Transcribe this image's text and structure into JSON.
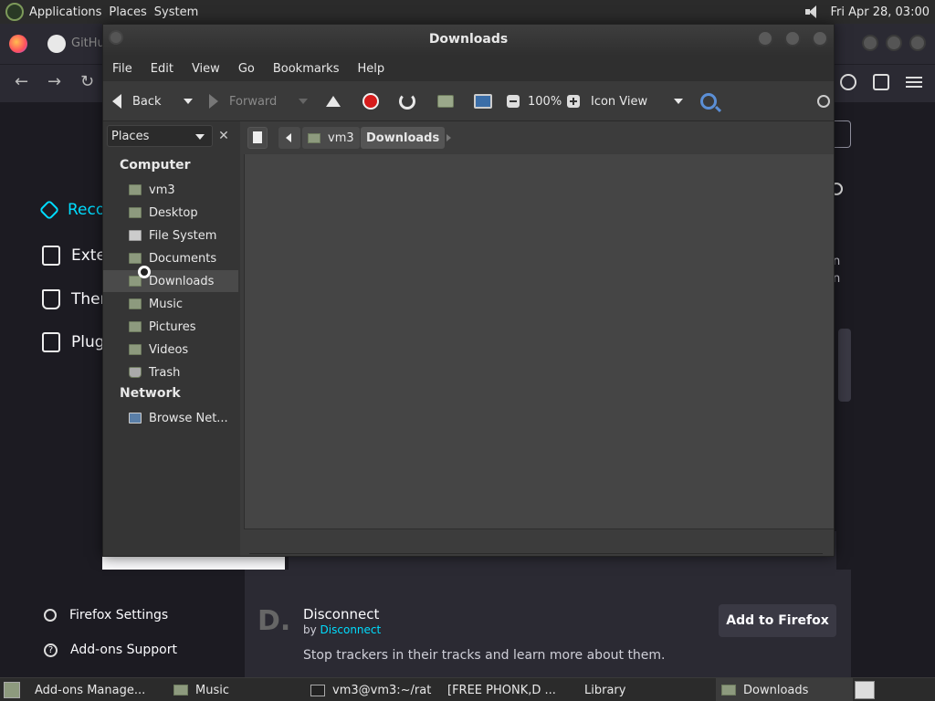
{
  "top_panel": {
    "menus": [
      "Applications",
      "Places",
      "System"
    ],
    "clock": "Fri Apr 28, 03:00"
  },
  "firefox": {
    "tab_partial": "GitHub",
    "sidebar": [
      {
        "label": "Recommendations",
        "shown": "Reco"
      },
      {
        "label": "Extensions",
        "shown": "Exte"
      },
      {
        "label": "Themes",
        "shown": "Ther"
      },
      {
        "label": "Plugins",
        "shown": "Plug"
      }
    ],
    "sidebar_bottom": [
      "Firefox Settings",
      "Add-ons Support"
    ],
    "peek_text": [
      "n",
      "n"
    ],
    "extension_card": {
      "logo": "D.",
      "name": "Disconnect",
      "by_prefix": "by",
      "author": "Disconnect",
      "description": "Stop trackers in their tracks and learn more about them.",
      "button": "Add to Firefox"
    }
  },
  "file_manager": {
    "title": "Downloads",
    "menu": [
      "File",
      "Edit",
      "View",
      "Go",
      "Bookmarks",
      "Help"
    ],
    "toolbar": {
      "back": "Back",
      "forward": "Forward",
      "zoom": "100%",
      "view_mode": "Icon View"
    },
    "sidebar": {
      "selector": "Places",
      "close": "✕",
      "computer_header": "Computer",
      "network_header": "Network",
      "items": [
        "vm3",
        "Desktop",
        "File System",
        "Documents",
        "Downloads",
        "Music",
        "Pictures",
        "Videos",
        "Trash"
      ],
      "network_items": [
        "Browse Net..."
      ]
    },
    "path": [
      "vm3",
      "Downloads"
    ]
  },
  "taskbar": {
    "tasks": [
      "Add-ons Manage...",
      "Music",
      "vm3@vm3:~/rat",
      "[FREE PHONK,D ...",
      "Library",
      "Downloads"
    ]
  }
}
